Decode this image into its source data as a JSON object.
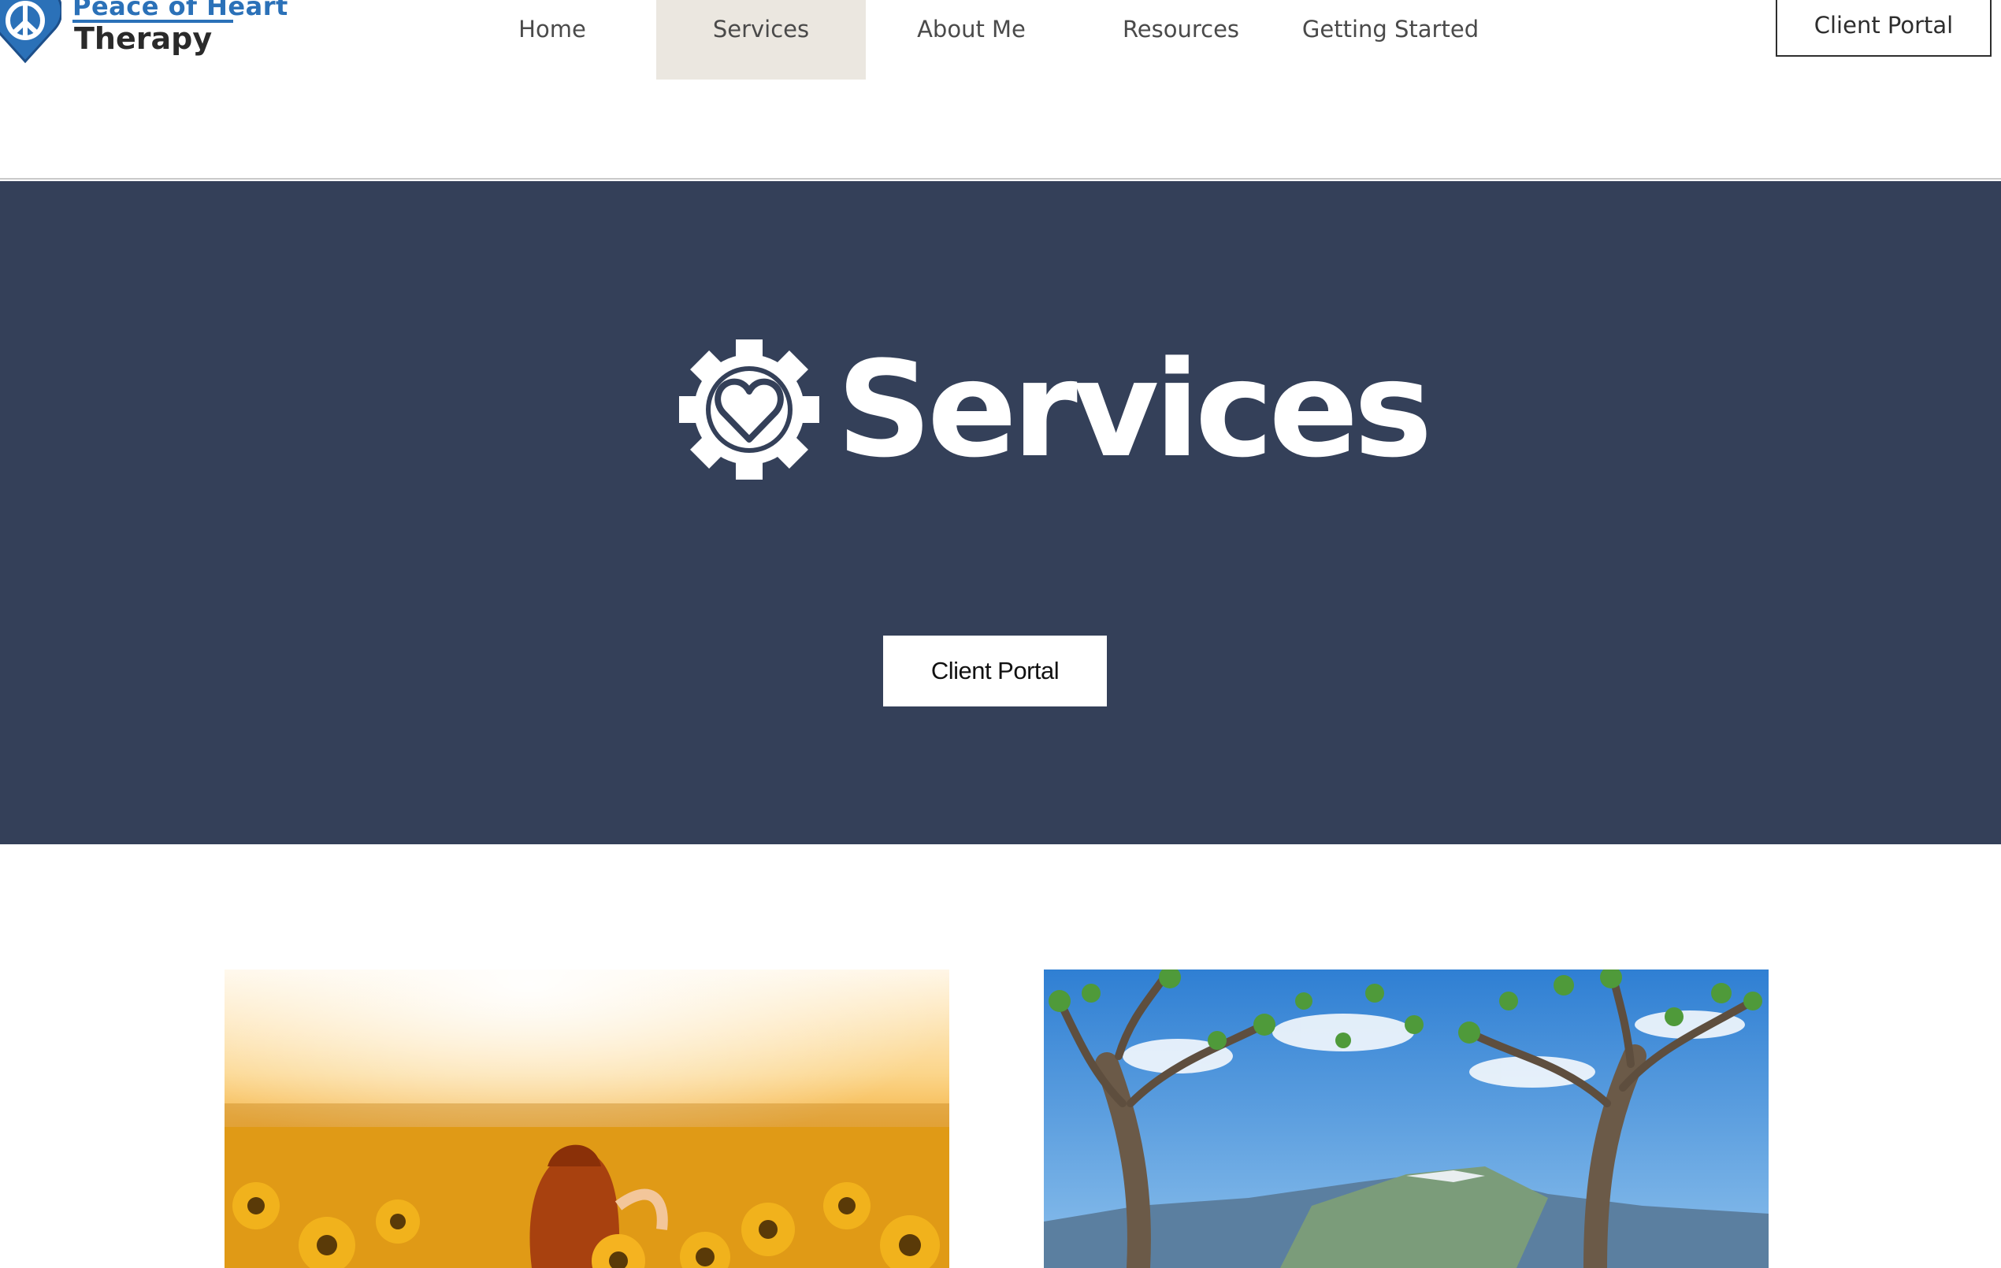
{
  "header": {
    "logo": {
      "line1": "Peace of Heart",
      "line2": "Therapy",
      "icon": "peace-heart-logo-icon"
    },
    "nav": [
      {
        "label": "Home",
        "active": false
      },
      {
        "label": "Services",
        "active": true
      },
      {
        "label": "About Me",
        "active": false
      },
      {
        "label": "Resources",
        "active": false
      },
      {
        "label": "Getting Started",
        "active": false
      }
    ],
    "portal_button": "Client Portal"
  },
  "hero": {
    "icon": "gear-heart-icon",
    "title": "Services",
    "button": "Client Portal"
  },
  "photos": [
    {
      "icon": "sunflower-field-photo"
    },
    {
      "icon": "trees-mountains-photo"
    }
  ],
  "colors": {
    "hero_bg": "#344059",
    "nav_active_bg": "#ebe7e0",
    "logo_blue": "#2b71b8",
    "text_dark": "#2a2a2a"
  }
}
